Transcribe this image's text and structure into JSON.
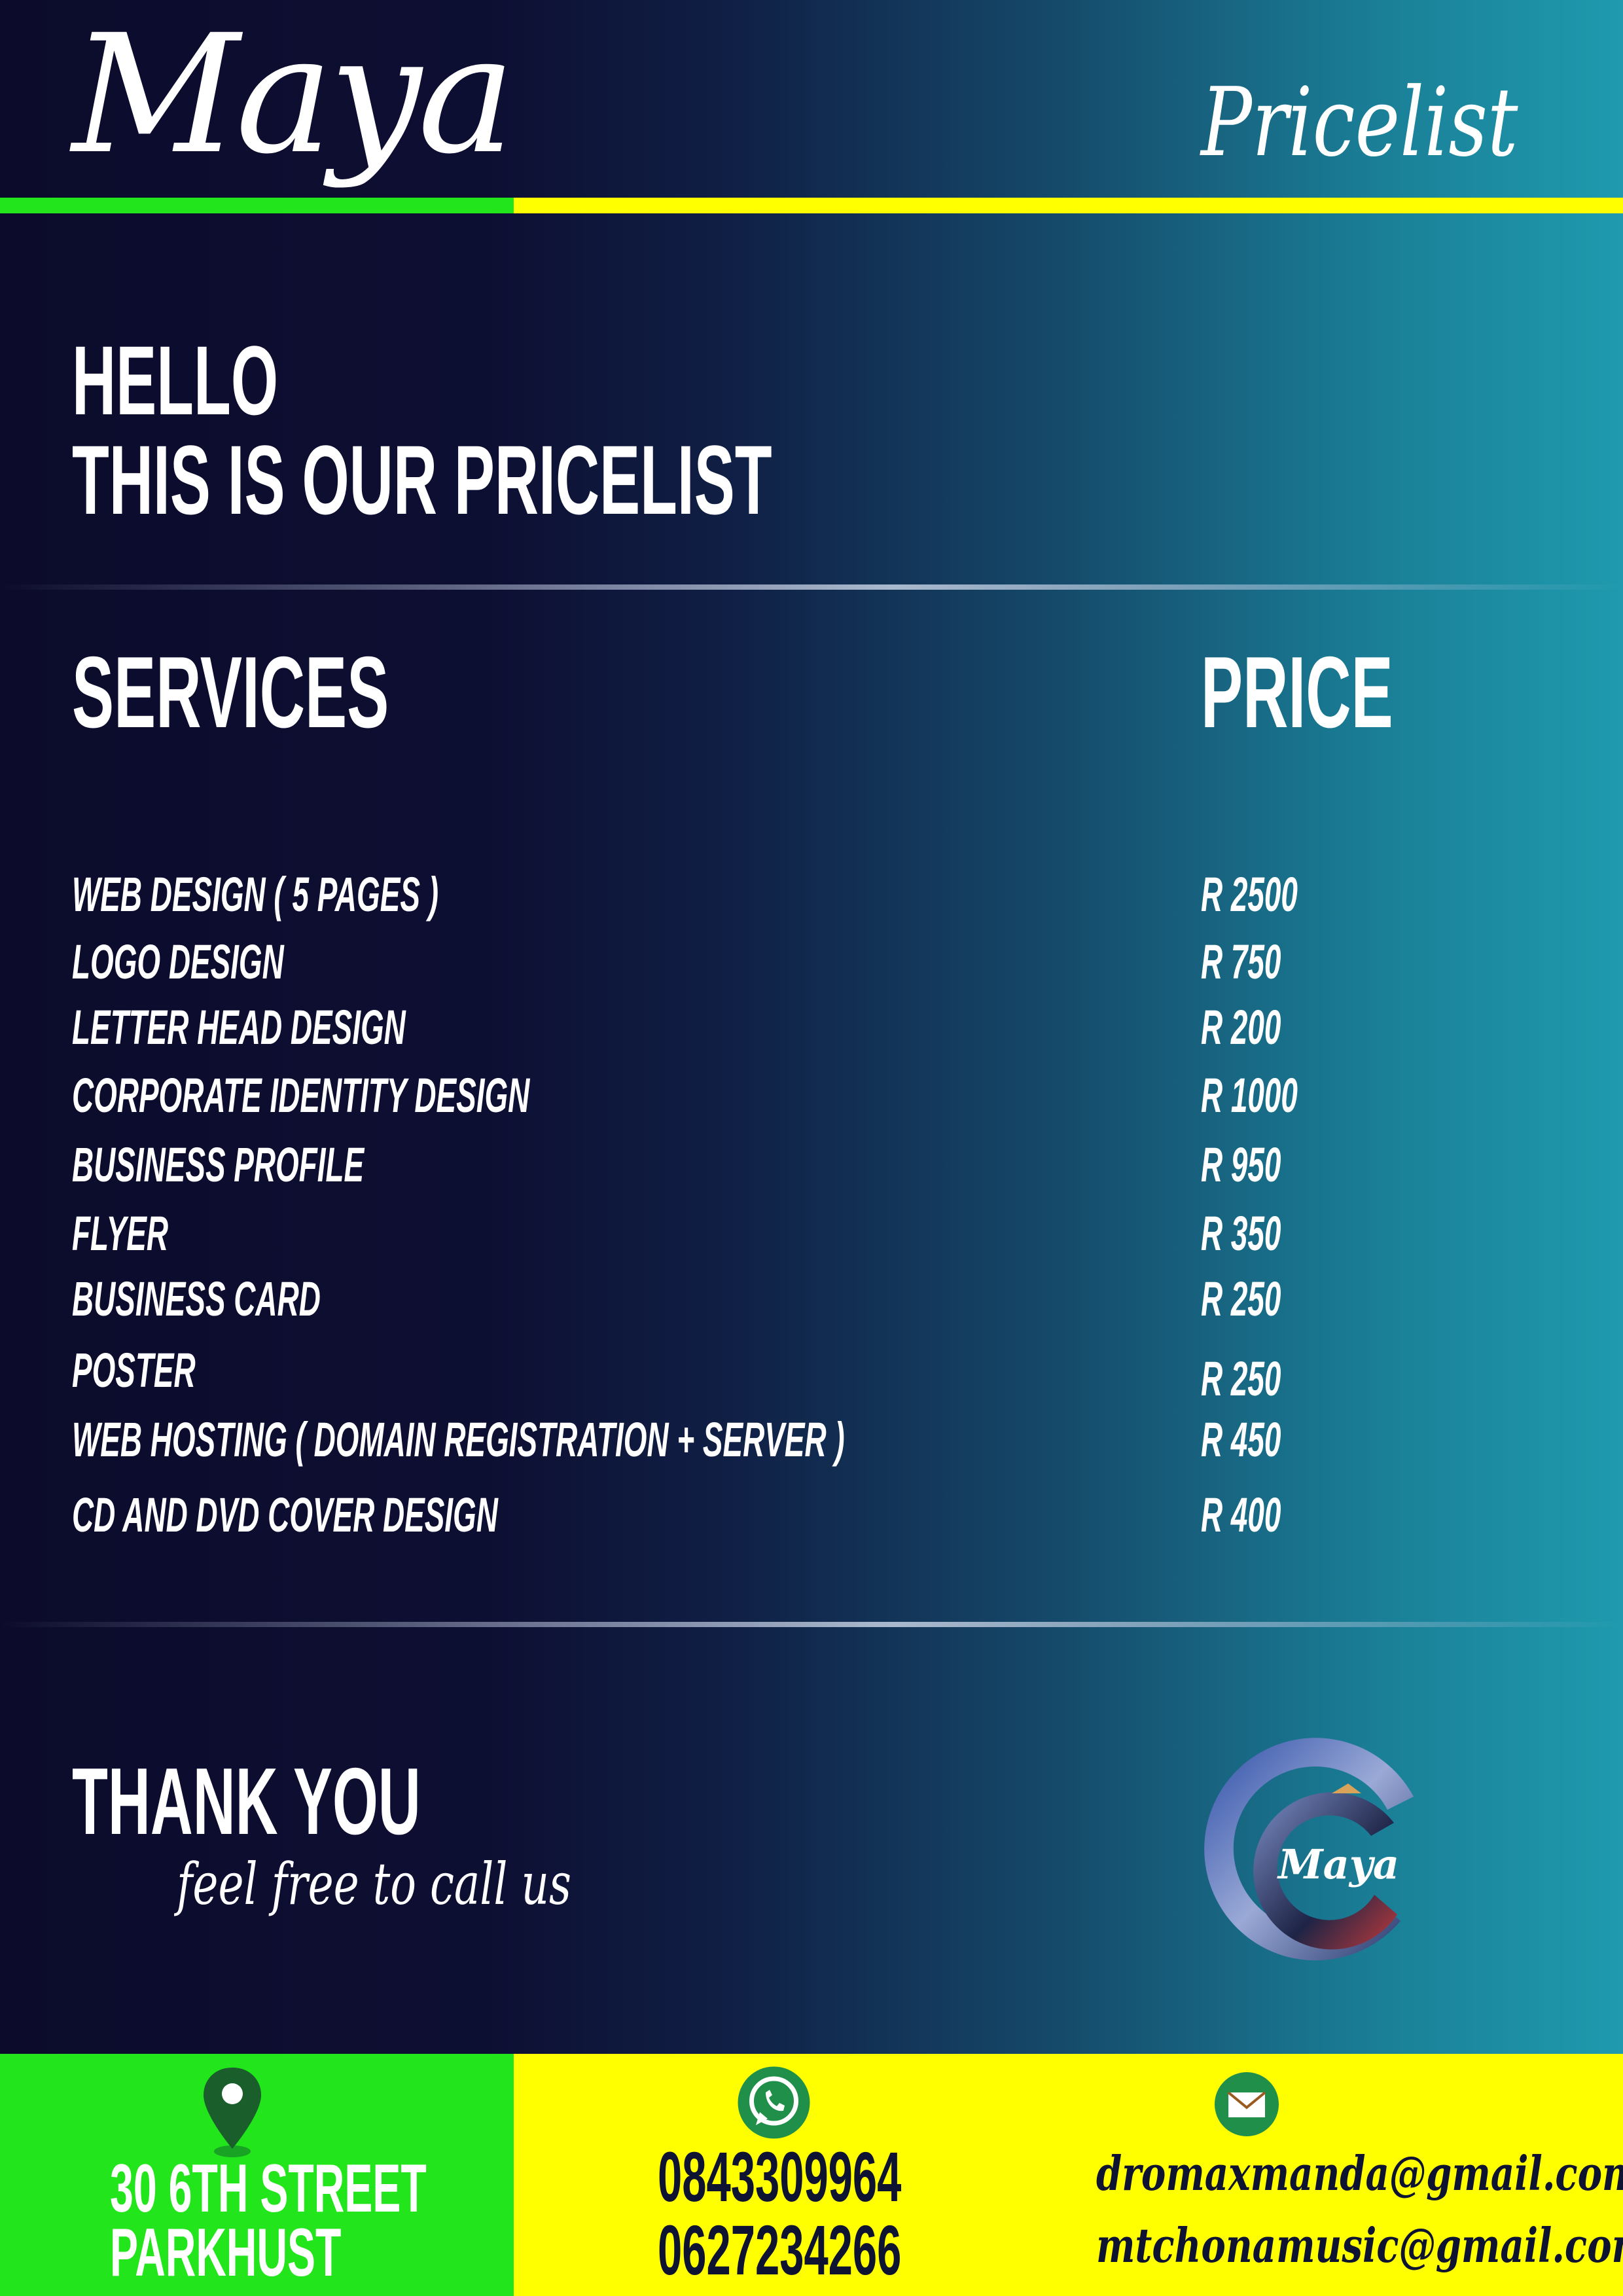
{
  "header": {
    "brand": "Maya",
    "document_title": "Pricelist"
  },
  "intro": {
    "line1": "HELLO",
    "line2": "THIS IS OUR PRICELIST"
  },
  "table": {
    "col_services": "SERVICES",
    "col_price": "PRICE",
    "rows": [
      {
        "service": "WEB DESIGN  ( 5 PAGES )",
        "price": "R 2500"
      },
      {
        "service": "LOGO DESIGN",
        "price": "R 750"
      },
      {
        "service": "LETTER HEAD DESIGN",
        "price": "R 200"
      },
      {
        "service": "CORPORATE IDENTITY DESIGN",
        "price": "R 1000"
      },
      {
        "service": "BUSINESS PROFILE",
        "price": "R 950"
      },
      {
        "service": "FLYER",
        "price": "R 350"
      },
      {
        "service": "BUSINESS CARD",
        "price": "R 250"
      },
      {
        "service": "POSTER",
        "price": "R 250"
      },
      {
        "service": "WEB HOSTING   ( DOMAIN REGISTRATION + SERVER )",
        "price": "R 450"
      },
      {
        "service": "CD AND DVD COVER DESIGN",
        "price": "R 400"
      }
    ]
  },
  "closing": {
    "thank_you": "THANK YOU",
    "call_us": "feel free to call us"
  },
  "logo": {
    "word": "Maya"
  },
  "footer": {
    "address_line1": "30 6TH STREET",
    "address_line2": "PARKHUST",
    "phone1": "0843309964",
    "phone2": "0627234266",
    "email1": "dromaxmanda@gmail.com",
    "email2": "mtchonamusic@gmail.com",
    "icons": [
      "location-pin-icon",
      "whatsapp-icon",
      "mail-icon"
    ]
  },
  "colors": {
    "green": "#22e51c",
    "yellow": "#ffff00",
    "navy": "#0c0b2c",
    "teal": "#1f9aae"
  }
}
